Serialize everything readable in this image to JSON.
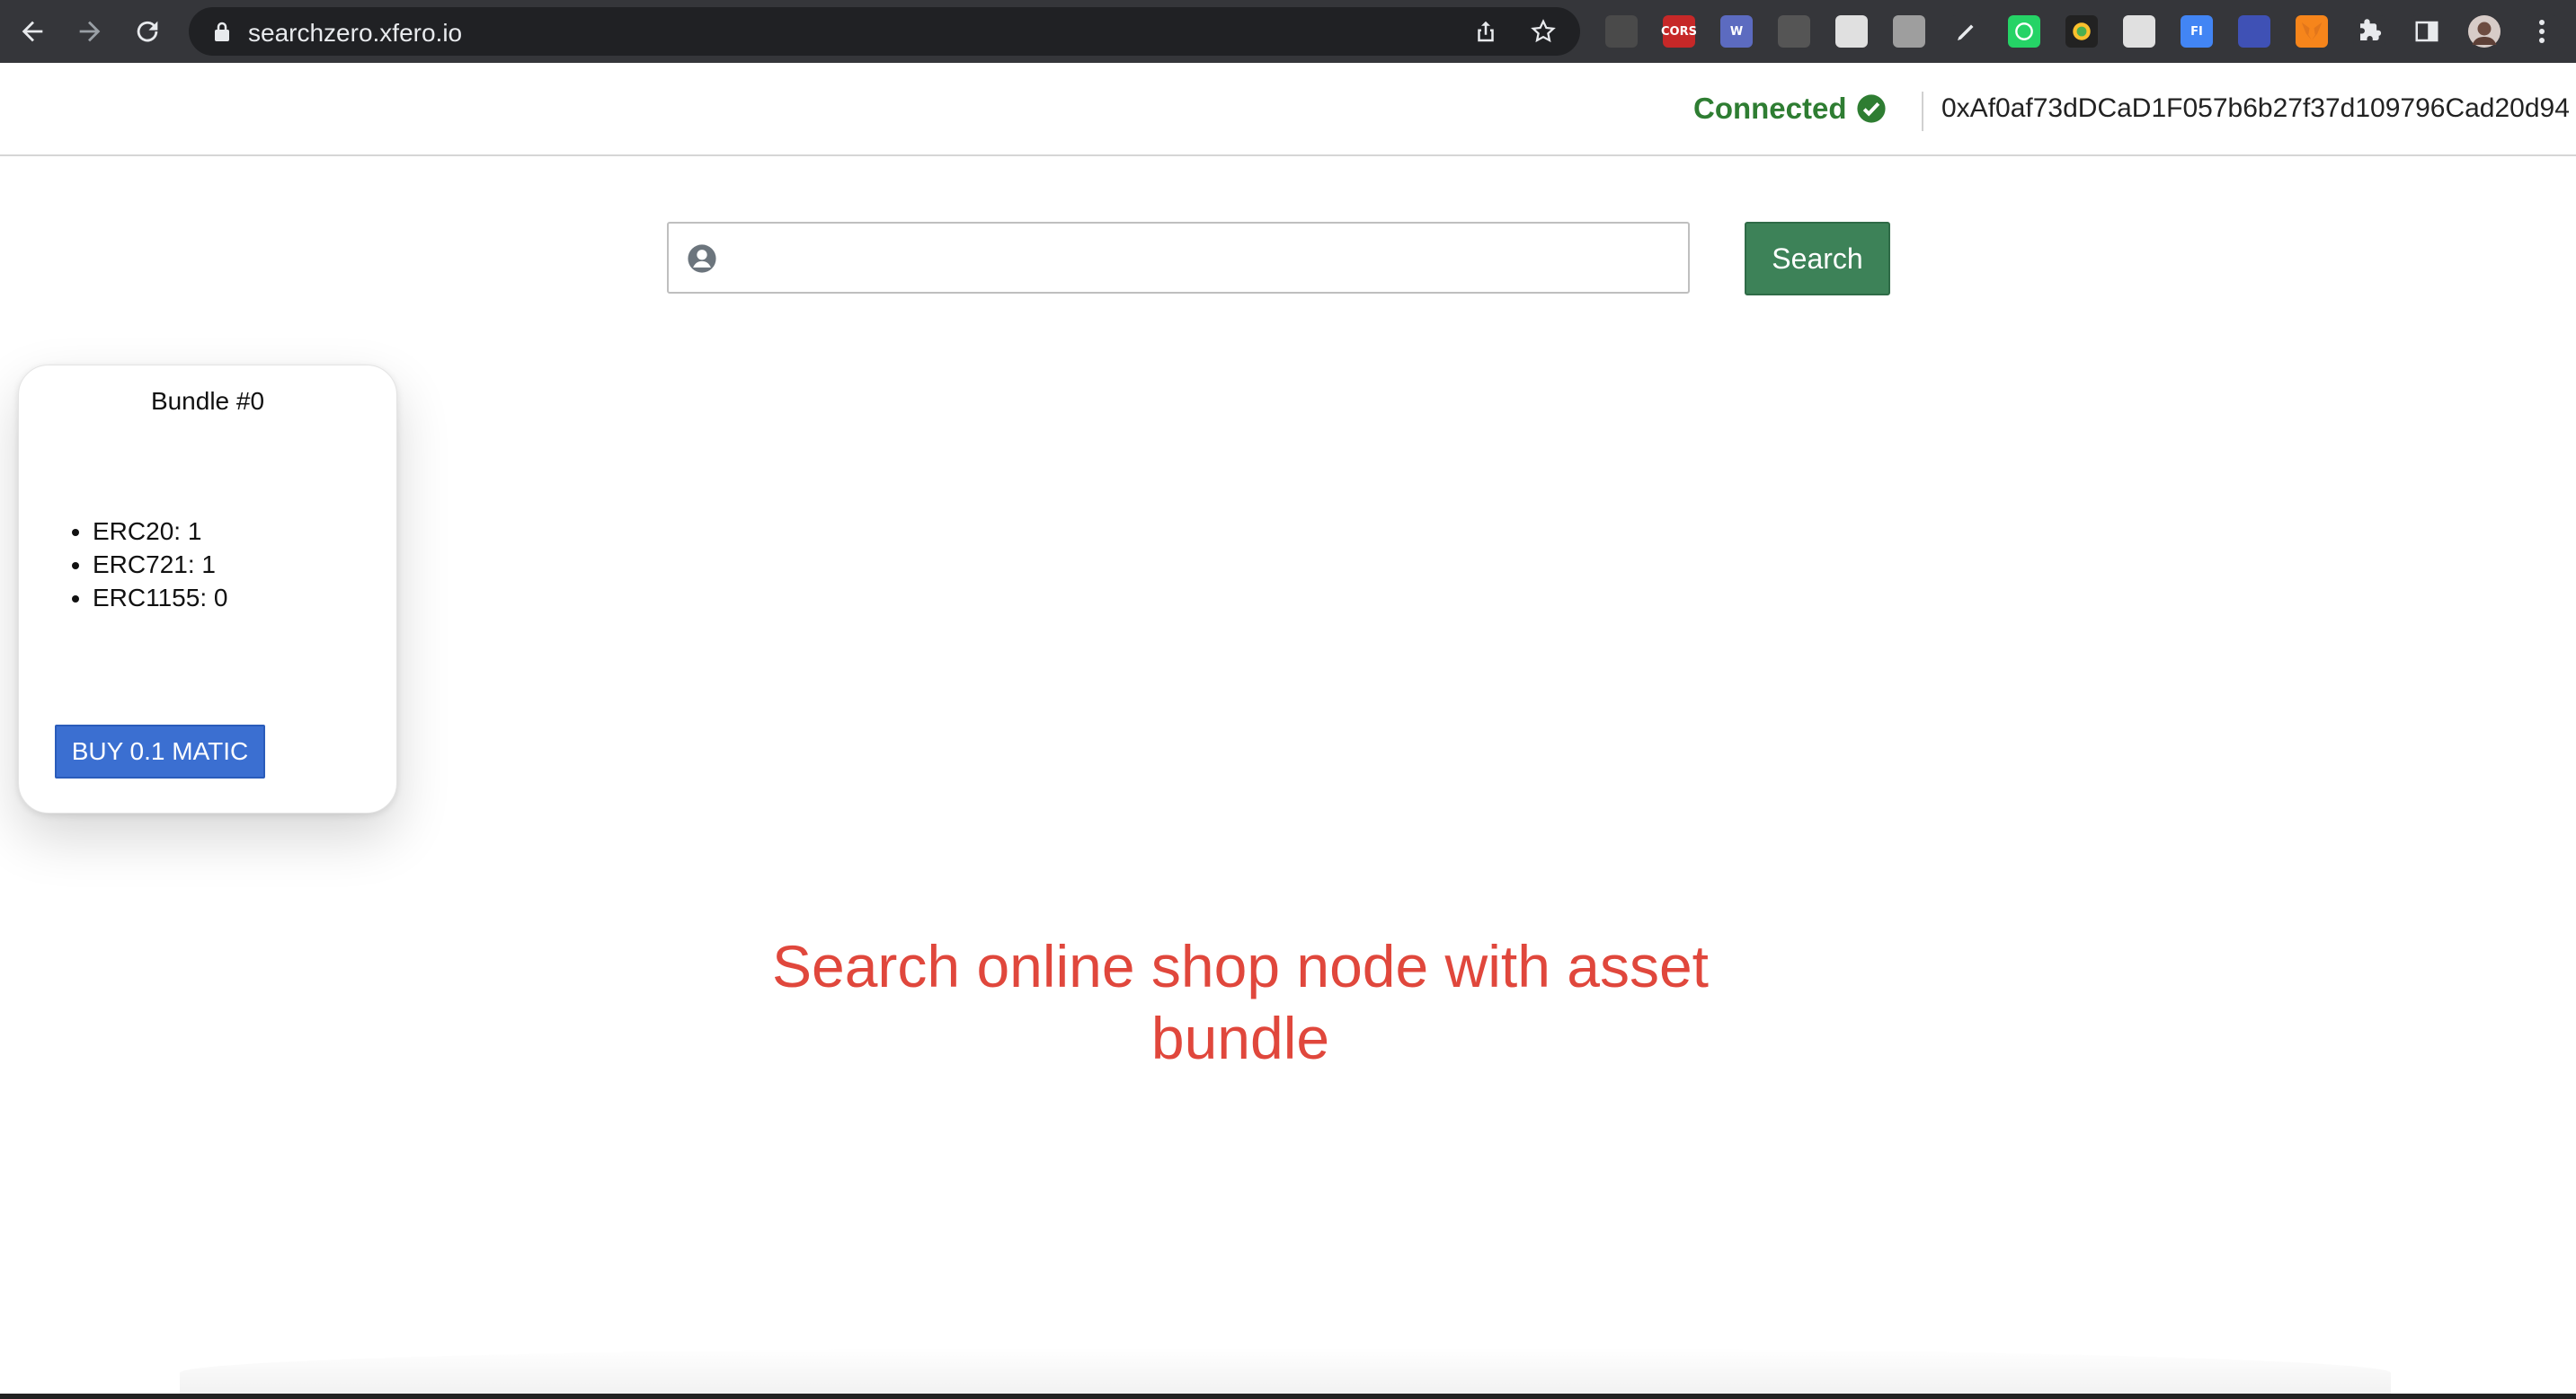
{
  "browser": {
    "url": "searchzero.xfero.io",
    "nav": [
      "back-icon",
      "forward-icon",
      "reload-icon"
    ],
    "extensions": [
      {
        "name": "ext-stack-icon",
        "color": "#4a4a4a",
        "label": ""
      },
      {
        "name": "ext-cors-icon",
        "color": "#c62828",
        "label": "CORS"
      },
      {
        "name": "ext-web3-icon",
        "color": "#5c6bc0",
        "label": "W"
      },
      {
        "name": "ext-tab-icon",
        "color": "#555555",
        "label": ""
      },
      {
        "name": "ext-circle-icon",
        "color": "#e0e0e0",
        "label": ""
      },
      {
        "name": "ext-asterisk-icon",
        "color": "#9e9e9e",
        "label": ""
      },
      {
        "name": "ext-pen-icon",
        "color": "#35363a",
        "label": ""
      },
      {
        "name": "ext-whatsapp-icon",
        "color": "#25d366",
        "label": ""
      },
      {
        "name": "ext-color-icon",
        "color": "#222222",
        "label": ""
      },
      {
        "name": "ext-chat-icon",
        "color": "#e0e0e0",
        "label": ""
      },
      {
        "name": "ext-fi-icon",
        "color": "#4285f4",
        "label": "FI"
      },
      {
        "name": "ext-book-icon",
        "color": "#3f51b5",
        "label": ""
      },
      {
        "name": "ext-metamask-icon",
        "color": "#f6851b",
        "label": ""
      },
      {
        "name": "ext-puzzle-icon",
        "color": "#35363a",
        "label": ""
      },
      {
        "name": "ext-sidepanel-icon",
        "color": "#35363a",
        "label": ""
      },
      {
        "name": "profile-avatar",
        "color": "#8d6e63",
        "label": ""
      },
      {
        "name": "menu-kebab-icon",
        "color": "#35363a",
        "label": ""
      }
    ]
  },
  "header": {
    "status": "Connected",
    "status_color": "#2e7d32",
    "wallet_address": "0xAf0af73dDCaD1F057b6b27f37d109796Cad20d94"
  },
  "search": {
    "placeholder": "",
    "value": "",
    "button_label": "Search",
    "button_color": "#3d8258"
  },
  "bundle": {
    "title": "Bundle #0",
    "items": [
      {
        "label": "ERC20: 1"
      },
      {
        "label": "ERC721: 1"
      },
      {
        "label": "ERC1155: 0"
      }
    ],
    "buy_label": "BUY 0.1 MATIC",
    "buy_color": "#3b6fd1"
  },
  "tagline": {
    "line1": "Search online shop node with asset",
    "line2": "bundle",
    "color": "#e0473c"
  }
}
